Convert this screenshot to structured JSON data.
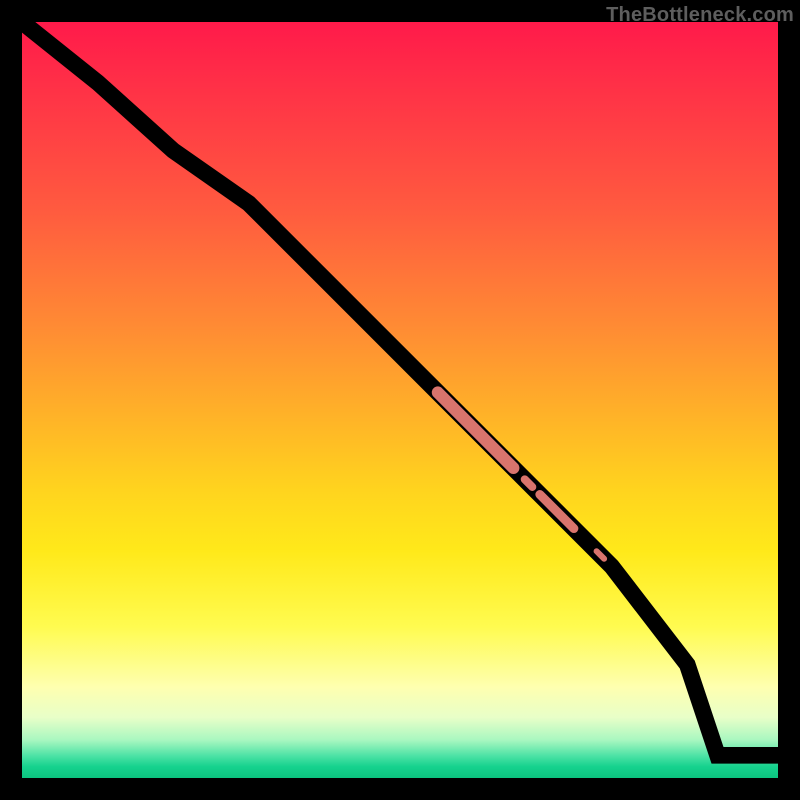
{
  "watermark": "TheBottleneck.com",
  "chart_data": {
    "type": "line",
    "title": "",
    "xlabel": "",
    "ylabel": "",
    "xlim": [
      0,
      100
    ],
    "ylim": [
      0,
      100
    ],
    "grid": false,
    "series": [
      {
        "name": "bottleneck-curve",
        "x": [
          0,
          10,
          20,
          30,
          40,
          50,
          58,
          64,
          68,
          72,
          78,
          88,
          92,
          100
        ],
        "y": [
          100,
          92,
          83,
          76,
          66,
          56,
          48,
          42,
          38,
          34,
          28,
          15,
          3,
          3
        ]
      }
    ],
    "highlights": [
      {
        "name": "segment-thick-1",
        "x0": 55,
        "y0": 51,
        "x1": 65,
        "y1": 41,
        "weight": 12
      },
      {
        "name": "dot-1",
        "x0": 66.5,
        "y0": 39.5,
        "x1": 67.5,
        "y1": 38.5,
        "weight": 8
      },
      {
        "name": "segment-thin-1",
        "x0": 68.5,
        "y0": 37.5,
        "x1": 73,
        "y1": 33,
        "weight": 9
      },
      {
        "name": "dot-2",
        "x0": 76,
        "y0": 30,
        "x1": 77,
        "y1": 29,
        "weight": 6
      }
    ],
    "background_gradient": {
      "type": "vertical",
      "stops": [
        {
          "pos": 0.0,
          "color": "#ff1a4a"
        },
        {
          "pos": 0.25,
          "color": "#ff5b3f"
        },
        {
          "pos": 0.52,
          "color": "#ffb228"
        },
        {
          "pos": 0.7,
          "color": "#ffe91a"
        },
        {
          "pos": 0.88,
          "color": "#feffb0"
        },
        {
          "pos": 0.97,
          "color": "#4fe3a6"
        },
        {
          "pos": 1.0,
          "color": "#0cc47f"
        }
      ]
    }
  }
}
